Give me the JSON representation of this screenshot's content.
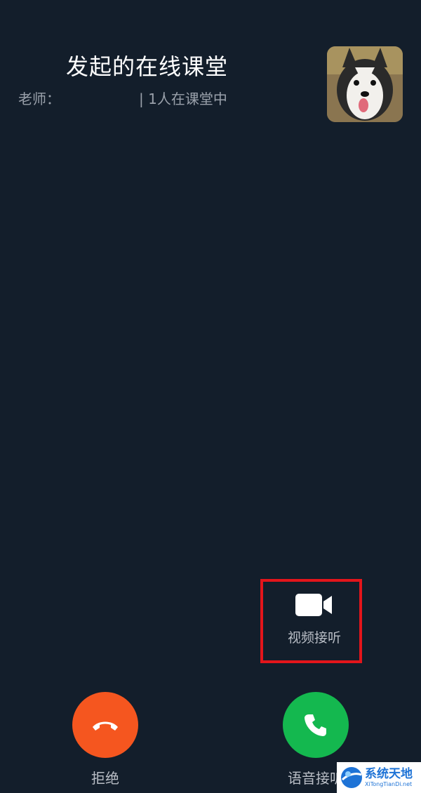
{
  "header": {
    "title": "发起的在线课堂",
    "teacher_label": "老师：",
    "status": "| 1人在课堂中"
  },
  "avatar": {
    "alt": "dog avatar"
  },
  "actions": {
    "video_answer": {
      "label": "视频接听",
      "icon": "video-camera-icon"
    },
    "reject": {
      "label": "拒绝",
      "icon": "hang-up-icon",
      "color": "#f5561f"
    },
    "voice_answer": {
      "label": "语音接听",
      "icon": "phone-icon",
      "color": "#14b84f"
    }
  },
  "highlight_color": "#e3151b",
  "watermark": {
    "text": "系统天地",
    "subtext": "XiTongTianDi.net"
  }
}
